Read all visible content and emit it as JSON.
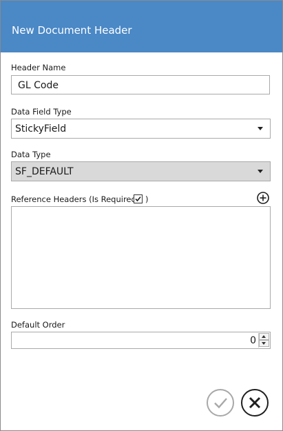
{
  "dialog": {
    "title": "New Document Header"
  },
  "header_name": {
    "label": "Header Name",
    "value": "GL Code"
  },
  "data_field_type": {
    "label": "Data Field Type",
    "selected": "StickyField"
  },
  "data_type": {
    "label": "Data Type",
    "selected": "SF_DEFAULT",
    "enabled": false
  },
  "reference_headers": {
    "label": "Reference Headers (Is Required",
    "label_close": ")",
    "is_required_checked": true,
    "items": [],
    "add_icon": "plus-circle-icon"
  },
  "default_order": {
    "label": "Default Order",
    "value": "0"
  },
  "actions": {
    "ok_icon": "check-icon",
    "cancel_icon": "close-icon"
  },
  "colors": {
    "titlebar": "#4a88c6",
    "title_text": "#ffffff",
    "disabled_field": "#d9d9d9"
  }
}
